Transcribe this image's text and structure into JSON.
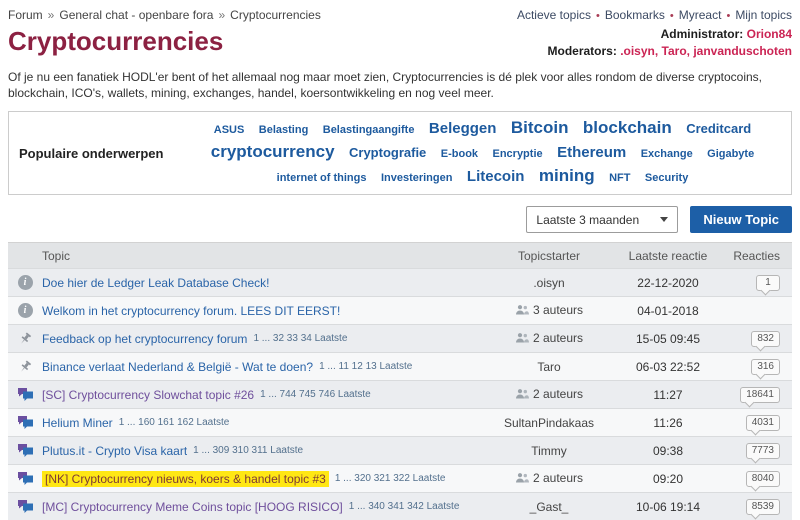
{
  "topbar": {
    "breadcrumb": {
      "items": [
        "Forum",
        "General chat - openbare fora",
        "Cryptocurrencies"
      ],
      "separator": "»"
    },
    "nav": {
      "items": [
        "Actieve topics",
        "Bookmarks",
        "Myreact",
        "Mijn topics"
      ],
      "separator": "•"
    }
  },
  "header": {
    "title": "Cryptocurrencies",
    "administrator_label": "Administrator:",
    "administrator": "Orion84",
    "moderators_label": "Moderators:",
    "moderators": ".oisyn, Taro, janvanduschoten"
  },
  "description": "Of je nu een fanatiek HODL'er bent of het allemaal nog maar moet zien, Cryptocurrencies is dé plek voor alles rondom de diverse cryptocoins, blockchain, ICO's, wallets, mining, exchanges, handel, koersontwikkeling en nog veel meer.",
  "popular": {
    "label": "Populaire onderwerpen",
    "tags": [
      {
        "label": "ASUS"
      },
      {
        "label": "Belasting"
      },
      {
        "label": "Belastingaangifte"
      },
      {
        "label": "Beleggen"
      },
      {
        "label": "Bitcoin"
      },
      {
        "label": "blockchain"
      },
      {
        "label": "Creditcard"
      },
      {
        "label": "cryptocurrency"
      },
      {
        "label": "Cryptografie"
      },
      {
        "label": "E-book"
      },
      {
        "label": "Encryptie"
      },
      {
        "label": "Ethereum"
      },
      {
        "label": "Exchange"
      },
      {
        "label": "Gigabyte"
      },
      {
        "label": "internet of things"
      },
      {
        "label": "Investeringen"
      },
      {
        "label": "Litecoin"
      },
      {
        "label": "mining"
      },
      {
        "label": "NFT"
      },
      {
        "label": "Security"
      }
    ]
  },
  "filter": {
    "period_selected": "Laatste 3 maanden",
    "new_topic_label": "Nieuw Topic"
  },
  "table": {
    "headers": {
      "topic": "Topic",
      "starter": "Topicstarter",
      "last": "Laatste reactie",
      "replies": "Reacties"
    },
    "rows": [
      {
        "icon": "info",
        "title": "Doe hier de Ledger Leak Database Check!",
        "pages": "",
        "starter": ".oisyn",
        "last": "22-12-2020",
        "replies": "1"
      },
      {
        "icon": "info",
        "title": "Welkom in het cryptocurrency forum. LEES DIT EERST!",
        "pages": "",
        "starter": "3 auteurs",
        "last": "04-01-2018",
        "replies": ""
      },
      {
        "icon": "pin",
        "title": "Feedback op het cryptocurrency forum",
        "pages": "1 ... 32 33 34 Laatste",
        "starter": "2 auteurs",
        "last": "15-05 09:45",
        "replies": "832"
      },
      {
        "icon": "pin",
        "title": "Binance verlaat Nederland & België - Wat te doen?",
        "pages": "1 ... 11 12 13 Laatste",
        "starter": "Taro",
        "last": "06-03 22:52",
        "replies": "316"
      },
      {
        "icon": "chat",
        "title": "[SC] Cryptocurrency Slowchat topic #26",
        "pages": "1 ... 744 745 746 Laatste",
        "starter": "2 auteurs",
        "last": "11:27",
        "replies": "18641"
      },
      {
        "icon": "chat",
        "title": "Helium Miner",
        "pages": "1 ... 160 161 162 Laatste",
        "starter": "SultanPindakaas",
        "last": "11:26",
        "replies": "4031"
      },
      {
        "icon": "chat",
        "title": "Plutus.it - Crypto Visa kaart",
        "pages": "1 ... 309 310 311 Laatste",
        "starter": "Timmy",
        "last": "09:38",
        "replies": "7773"
      },
      {
        "icon": "chat",
        "title": "[NK] Cryptocurrency nieuws, koers & handel topic #3",
        "pages": "1 ... 320 321 322 Laatste",
        "starter": "2 auteurs",
        "last": "09:20",
        "replies": "8040"
      },
      {
        "icon": "chat",
        "title": "[MC] Cryptocurrency Meme Coins topic [HOOG RISICO]",
        "pages": "1 ... 340 341 342 Laatste",
        "starter": "_Gast_",
        "last": "10-06 19:14",
        "replies": "8539"
      }
    ]
  },
  "colors": {
    "title_maroon": "#8c2142",
    "link_blue": "#2a64a8",
    "visited_purple": "#6f4f9c",
    "tag_blue": "#1d5a9e",
    "moderator_pink": "#cb2454",
    "button_blue": "#1d5fa7",
    "highlight_yellow": "#ffe714"
  }
}
